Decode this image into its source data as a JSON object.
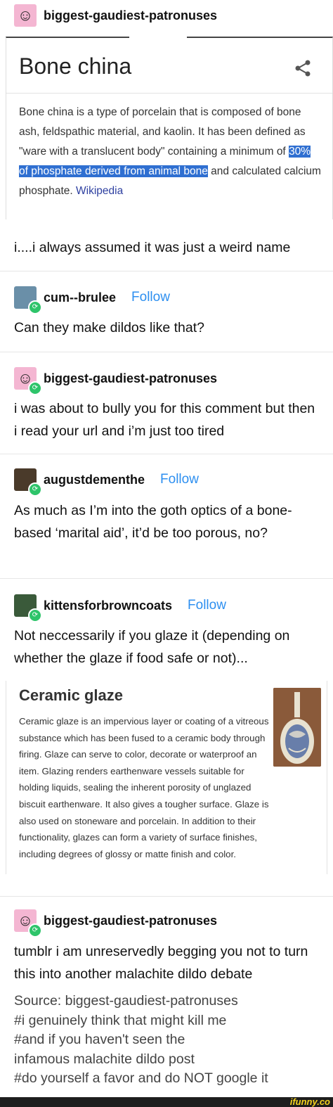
{
  "posts": [
    {
      "username": "biggest-gaudiest-patronuses"
    },
    {
      "username": "cum--brulee",
      "follow": "Follow",
      "text": "Can they make dildos like that?"
    },
    {
      "username": "biggest-gaudiest-patronuses",
      "text": "i was about to bully you for this comment but then i read your url and i’m just too tired"
    },
    {
      "username": "augustdementhe",
      "follow": "Follow",
      "text": "As much as I’m into the goth optics of a bone-based ‘marital aid’, it’d be too porous, no?"
    },
    {
      "username": "kittensforbrowncoats",
      "follow": "Follow",
      "text": "Not neccessarily if you glaze it (depending on whether the glaze if food safe or not)..."
    },
    {
      "username": "biggest-gaudiest-patronuses",
      "text": "tumblr i am unreservedly begging you not to turn this into another malachite dildo debate"
    }
  ],
  "op_caption": "i....i always assumed it was just a weird name",
  "wiki_card": {
    "title": "Bone china",
    "body_before": "Bone china is a type of porcelain that is composed of bone ash, feldspathic material, and kaolin. It has been defined as \"ware with a translucent body\" containing a minimum of ",
    "body_highlight": "30% of phosphate derived from animal bone",
    "body_after": " and calculated calcium phosphate. ",
    "source_link": "Wikipedia"
  },
  "glaze_card": {
    "title": "Ceramic glaze",
    "body": "Ceramic glaze is an impervious layer or coating of a vitreous substance which has been fused to a ceramic body through firing. Glaze can serve to color, decorate or waterproof an item. Glazing renders earthenware vessels suitable for holding liquids, sealing the inherent porosity of unglazed biscuit earthenware. It also gives a tougher surface. Glaze is also used on stoneware and porcelain. In addition to their functionality, glazes can form a variety of surface finishes, including degrees of glossy or matte finish and color."
  },
  "source": {
    "line": "Source: biggest-gaudiest-patronuses",
    "tags": [
      "#i genuinely think that might kill me",
      "#and if you haven't seen the",
      "infamous malachite dildo post",
      "#do yourself a favor and do NOT google it"
    ]
  },
  "watermark": "ifunny.co"
}
